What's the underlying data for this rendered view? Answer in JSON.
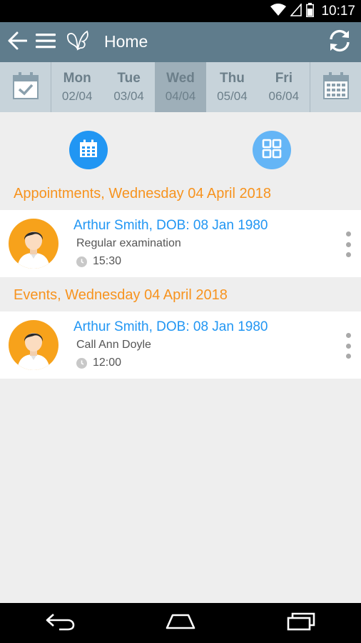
{
  "status_bar": {
    "time": "10:17"
  },
  "app_bar": {
    "title": "Home"
  },
  "week": {
    "days": [
      {
        "name": "Mon",
        "date": "02/04",
        "selected": false
      },
      {
        "name": "Tue",
        "date": "03/04",
        "selected": false
      },
      {
        "name": "Wed",
        "date": "04/04",
        "selected": true
      },
      {
        "name": "Thu",
        "date": "05/04",
        "selected": false
      },
      {
        "name": "Fri",
        "date": "06/04",
        "selected": false
      }
    ]
  },
  "sections": {
    "appointments": {
      "title": "Appointments, Wednesday 04 April 2018",
      "items": [
        {
          "name": "Arthur Smith, DOB: 08 Jan 1980",
          "description": "Regular examination",
          "time": "15:30"
        }
      ]
    },
    "events": {
      "title": "Events, Wednesday 04 April 2018",
      "items": [
        {
          "name": "Arthur Smith, DOB: 08 Jan 1980",
          "description": "Call Ann Doyle",
          "time": "12:00"
        }
      ]
    }
  },
  "colors": {
    "app_bar": "#5f7c8c",
    "week_bar": "#c7d3da",
    "week_selected": "#9eafb9",
    "accent_orange": "#f7931e",
    "accent_blue": "#2196f3",
    "background": "#eeeeee"
  },
  "icons": {
    "status": [
      "wifi-icon",
      "signal-icon",
      "battery-icon"
    ],
    "app_bar": [
      "back-arrow-icon",
      "menu-icon",
      "butterfly-logo-icon",
      "sync-icon"
    ],
    "week": [
      "calendar-check-icon",
      "calendar-month-icon"
    ],
    "actions": [
      "calendar-icon",
      "grid-icon"
    ],
    "nav": [
      "back-icon",
      "home-icon",
      "recents-icon"
    ]
  }
}
